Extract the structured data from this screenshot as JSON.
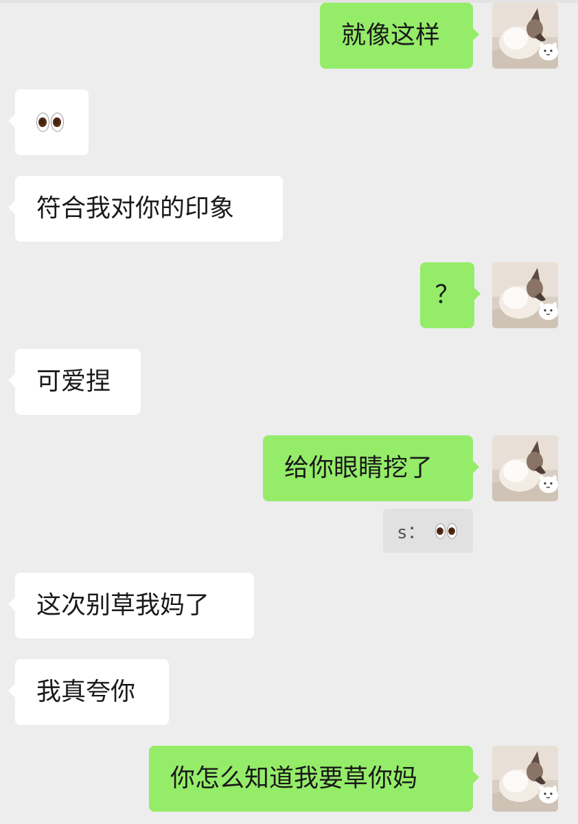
{
  "messages": [
    {
      "from": "me",
      "text": "就像这样"
    },
    {
      "from": "them",
      "emoji": "eyes-emoji"
    },
    {
      "from": "them",
      "text": "符合我对你的印象"
    },
    {
      "from": "me",
      "text": "？"
    },
    {
      "from": "them",
      "text": "可爱捏"
    },
    {
      "from": "me",
      "text": "给你眼睛挖了"
    },
    {
      "from": "quote",
      "text": "s："
    },
    {
      "from": "them",
      "text": "这次别草我妈了"
    },
    {
      "from": "them",
      "text": "我真夸你"
    },
    {
      "from": "me",
      "text": "你怎么知道我要草你妈"
    }
  ],
  "avatar_icon": "cat-avatar-icon",
  "colors": {
    "background": "#ededed",
    "outgoing": "#95ec69",
    "incoming": "#ffffff",
    "quote": "#e1e1e1"
  }
}
